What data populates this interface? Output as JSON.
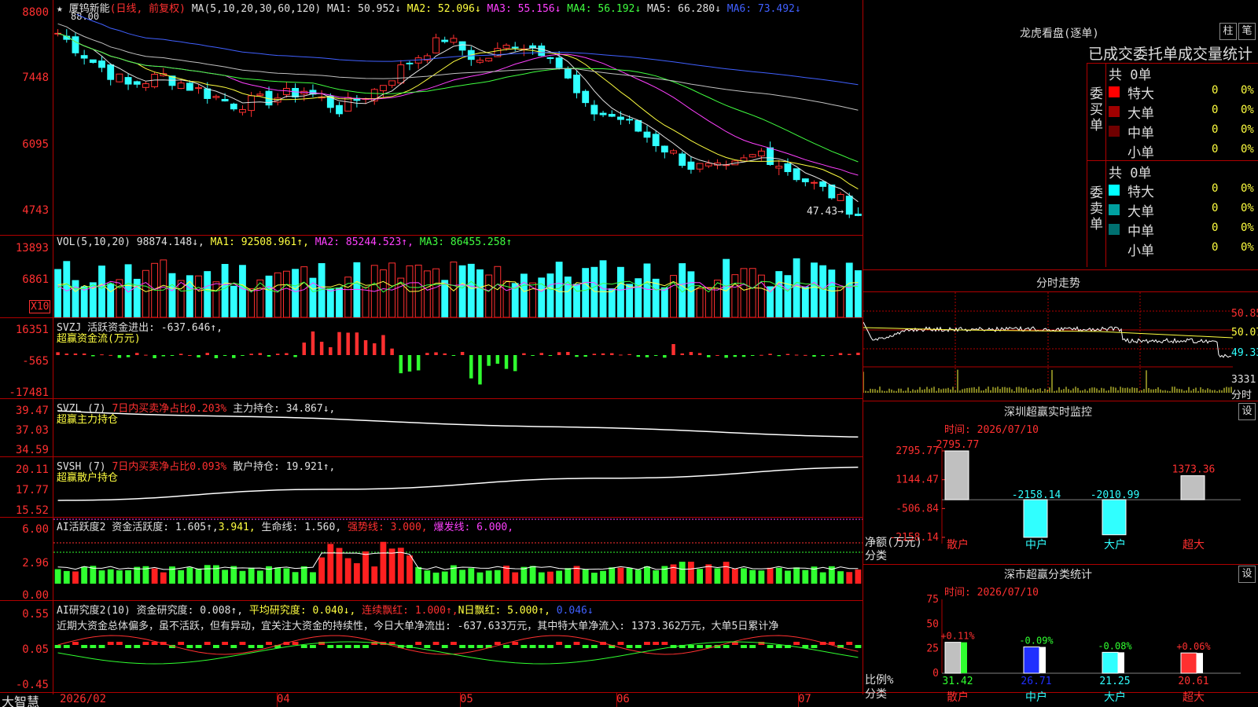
{
  "app": {
    "name": "大智慧"
  },
  "stock": {
    "name": "厦钨新能",
    "mode": "(日线, 前复权)",
    "max_label": "88.00",
    "last_label": "47.43→"
  },
  "ma_header": {
    "spec": "MA(5,10,20,30,60,120)",
    "ma1": "MA1: 50.952",
    "ma2": "MA2: 52.096",
    "ma3": "MA3: 55.156",
    "ma4": "MA4: 56.192",
    "ma5": "MA5: 66.280",
    "ma6": "MA6: 73.492",
    "arrow_down": "↓"
  },
  "price_axis": [
    "8800",
    "7448",
    "6095",
    "4743"
  ],
  "vol_header": {
    "spec": "VOL(5,10,20)",
    "v": "98874.148↓,",
    "ma1": "MA1: 92508.961↑,",
    "ma2": "MA2: 85244.523↑,",
    "ma3": "MA3: 86455.258↑"
  },
  "vol_axis": [
    "13893",
    "6861"
  ],
  "vol_unit": "X10",
  "svzj": {
    "title": "SVZJ  活跃资金进出: -637.646↑,",
    "sub": "超赢资金流(万元)",
    "axis": [
      "16351",
      "-565",
      "-17481"
    ]
  },
  "svzl": {
    "title": "SVZL (7)",
    "ratio": "7日内买卖净占比0.203%",
    "hold": "主力持仓: 34.867↓,",
    "sub": "超赢主力持仓",
    "axis": [
      "39.47",
      "37.03",
      "34.59"
    ]
  },
  "svsh": {
    "title": "SVSH (7)",
    "ratio": "7日内买卖净占比0.093%",
    "hold": "散户持仓: 19.921↑,",
    "sub": "超赢散户持仓",
    "axis": [
      "20.11",
      "17.77",
      "15.52"
    ]
  },
  "ai_active": {
    "title": "AI活跃度2 资金活跃度: 1.605↑,",
    "v2": "3.941,",
    "life": "生命线: 1.560,",
    "strong": "强势线: 3.000,",
    "burst": "爆发线: 6.000,",
    "axis": [
      "6.00",
      "2.96",
      "0.00"
    ]
  },
  "ai_research": {
    "title": "AI研究度2(10) 资金研究度: 0.008↑,",
    "avg": "平均研究度: 0.040↓,",
    "cont": "连续飘红: 1.000↑,",
    "nday": "N日飘红: 5.000↑,",
    "last": "0.046↓",
    "comment": "近期大资金总体偏多，虽不活跃，但有异动，宜关注大资金的持续性，今日大单净流出: -637.633万元，其中特大单净流入: 1373.362万元，大单5日累计净",
    "axis": [
      "0.55",
      "0.05",
      "-0.45"
    ]
  },
  "date_axis": [
    "2026/02",
    "04",
    "05",
    "06",
    "07"
  ],
  "right": {
    "lhb_title": "龙虎看盘(逐单)",
    "btn_zhu": "柱",
    "btn_bi": "笔",
    "stat_title": "已成交委托单成交量统计",
    "buy_label": "委买单",
    "sell_label": "委卖单",
    "buy_total": "共 0单",
    "sell_total": "共 0单",
    "rows": [
      "特大",
      "大单",
      "中单",
      "小单"
    ],
    "zero": "0",
    "pct": "0%",
    "buy_colors": [
      "#ff0000",
      "#a00000",
      "#700000",
      "#000000"
    ],
    "sell_colors": [
      "#00ffff",
      "#00a0a0",
      "#007070",
      "#000000"
    ],
    "fs_title": "分时走势",
    "fs_axis": [
      "50.85",
      "50.07",
      "49.33"
    ],
    "fs_vol": "3331",
    "fs_unit": "分时",
    "mon_title": "深圳超赢实时监控",
    "mon_date": "时间: 2026/07/10",
    "btn_set": "设",
    "mon_axis": [
      "2795.77",
      "1144.47",
      "-506.84",
      "-2158.14"
    ],
    "mon_unit": "净额(万元)",
    "cls": "分类",
    "mon_cats": [
      "散户",
      "中户",
      "大户",
      "超大"
    ],
    "mon_values_text": [
      "2795.77",
      "-2158.14",
      "-2010.99",
      "1373.36"
    ],
    "stat2_title": "深市超赢分类统计",
    "stat2_date": "时间: 2026/07/10",
    "stat2_axis": [
      "75",
      "50",
      "25",
      "0"
    ],
    "stat2_unit": "比例%",
    "stat2_change": [
      "+0.11%",
      "-0.09%",
      "-0.08%",
      "+0.06%"
    ],
    "stat2_values": [
      "31.42",
      "26.71",
      "21.25",
      "20.61"
    ]
  },
  "chart_data": [
    {
      "type": "bar",
      "title": "深圳超赢实时监控",
      "categories": [
        "散户",
        "中户",
        "大户",
        "超大"
      ],
      "values": [
        2795.77,
        -2158.14,
        -2010.99,
        1373.36
      ],
      "ylim": [
        -2158.14,
        2795.77
      ]
    },
    {
      "type": "bar",
      "title": "深市超赢分类统计",
      "categories": [
        "散户",
        "中户",
        "大户",
        "超大"
      ],
      "values": [
        31.42,
        26.71,
        21.25,
        20.61
      ],
      "ylim": [
        0,
        75
      ]
    }
  ]
}
